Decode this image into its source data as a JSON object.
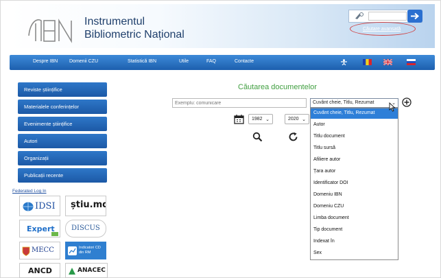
{
  "header": {
    "brand_line1": "Instrumentul",
    "brand_line2": "Bibliometric Național",
    "advanced_search": "Căutare avansată"
  },
  "navbar": {
    "items": [
      "Despre IBN",
      "Domenii CZU",
      "Statistică IBN",
      "Utile",
      "FAQ",
      "Contacte"
    ],
    "icons": [
      "accessibility-icon",
      "flag-romania-icon",
      "flag-uk-icon",
      "flag-russia-icon"
    ]
  },
  "sidebar": {
    "items": [
      "Reviste științifice",
      "Materialele conferințelor",
      "Evenimente științifice",
      "Autori",
      "Organizații",
      "Publicații recente"
    ],
    "federated_login": "Federated Log In",
    "partners": [
      "IDSI",
      "știu.md",
      "Expert",
      "DISCUS",
      "MECC",
      "Indicatori CD din RM",
      "ANCD",
      "ANACEC"
    ]
  },
  "main": {
    "title": "Căutarea documentelor",
    "query_placeholder": "Exemplu: comunicare",
    "field_selected": "Cuvânt cheie, Titlu, Rezumat",
    "year_from": "1982",
    "year_to": "2020",
    "field_options": [
      "Cuvânt cheie, Titlu, Rezumat",
      "Autor",
      "Titlu document",
      "Titlu sursă",
      "Afiliere autor",
      "Țara autor",
      "Identificator DOI",
      "Domeniu IBN",
      "Domeniu CZU",
      "Limba document",
      "Tip document",
      "Indexat în",
      "Sex"
    ],
    "field_options_highlighted_index": 0
  },
  "colors": {
    "nav_blue": "#2a6fc4",
    "title_green": "#3f9e3f",
    "highlight_blue": "#2e7fd8",
    "annotation_red": "#d04040"
  }
}
